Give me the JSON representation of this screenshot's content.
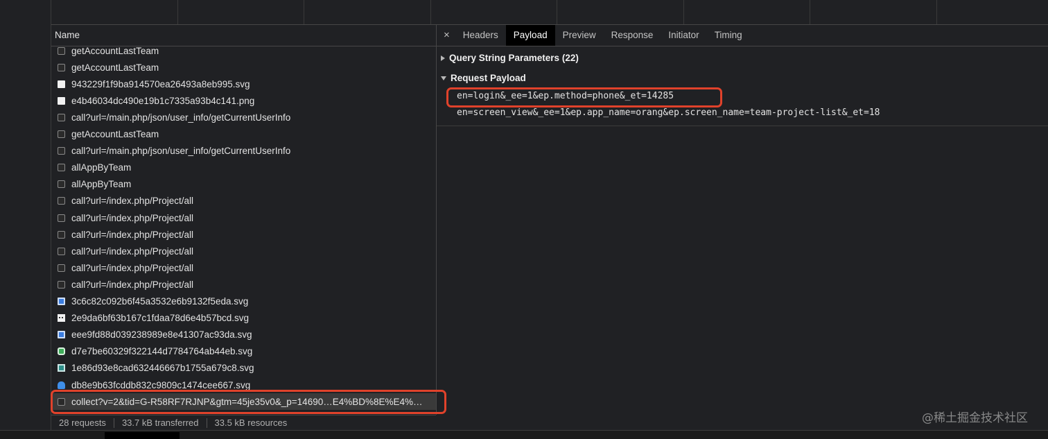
{
  "requests_panel": {
    "column_header": "Name",
    "rows": [
      {
        "name": "getAccountLastTeam",
        "icon": "document-icon"
      },
      {
        "name": "getAccountLastTeam",
        "icon": "document-icon"
      },
      {
        "name": "943229f1f9ba914570ea26493a8eb995.svg",
        "icon": "image-icon"
      },
      {
        "name": "e4b46034dc490e19b1c7335a93b4c141.png",
        "icon": "image-icon"
      },
      {
        "name": "call?url=/main.php/json/user_info/getCurrentUserInfo",
        "icon": "document-icon"
      },
      {
        "name": "getAccountLastTeam",
        "icon": "document-icon"
      },
      {
        "name": "call?url=/main.php/json/user_info/getCurrentUserInfo",
        "icon": "document-icon"
      },
      {
        "name": "allAppByTeam",
        "icon": "document-icon"
      },
      {
        "name": "allAppByTeam",
        "icon": "document-icon"
      },
      {
        "name": "call?url=/index.php/Project/all",
        "icon": "document-icon"
      },
      {
        "name": "call?url=/index.php/Project/all",
        "icon": "document-icon"
      },
      {
        "name": "call?url=/index.php/Project/all",
        "icon": "document-icon"
      },
      {
        "name": "call?url=/index.php/Project/all",
        "icon": "document-icon"
      },
      {
        "name": "call?url=/index.php/Project/all",
        "icon": "document-icon"
      },
      {
        "name": "call?url=/index.php/Project/all",
        "icon": "document-icon"
      },
      {
        "name": "3c6c82c092b6f45a3532e6b9132f5eda.svg",
        "icon": "blue-image-icon"
      },
      {
        "name": "2e9da6bf63b167c1fdaa78d6e4b57bcd.svg",
        "icon": "dots-image-icon"
      },
      {
        "name": "eee9fd88d039238989e8e41307ac93da.svg",
        "icon": "blue-image-icon"
      },
      {
        "name": "d7e7be60329f322144d7784764ab44eb.svg",
        "icon": "green-image-icon"
      },
      {
        "name": "1e86d93e8cad632446667b1755a679c8.svg",
        "icon": "teal-image-icon"
      },
      {
        "name": "db8e9b63fcddb832c9809c1474cee667.svg",
        "icon": "cloud-image-icon"
      },
      {
        "name": "collect?v=2&tid=G-R58RF7RJNP&gtm=45je35v0&_p=14690…E4%BD%8E%E4%…",
        "icon": "document-icon",
        "selected": true
      }
    ]
  },
  "status_bar": {
    "requests": "28 requests",
    "transferred": "33.7 kB transferred",
    "resources": "33.5 kB resources"
  },
  "detail_panel": {
    "close_glyph": "×",
    "tabs": [
      "Headers",
      "Payload",
      "Preview",
      "Response",
      "Initiator",
      "Timing"
    ],
    "active_tab": "Payload",
    "query_string_title": "Query String Parameters (22)",
    "request_payload_title": "Request Payload",
    "payload_lines": [
      "en=login&_ee=1&ep.method=phone&_et=14285",
      "en=screen_view&_ee=1&ep.app_name=orang&ep.screen_name=team-project-list&_et=18"
    ]
  },
  "watermark": "@稀土掘金技术社区",
  "colors": {
    "background": "#202124",
    "selected_tab": "#000000",
    "highlight": "#e0422b"
  }
}
